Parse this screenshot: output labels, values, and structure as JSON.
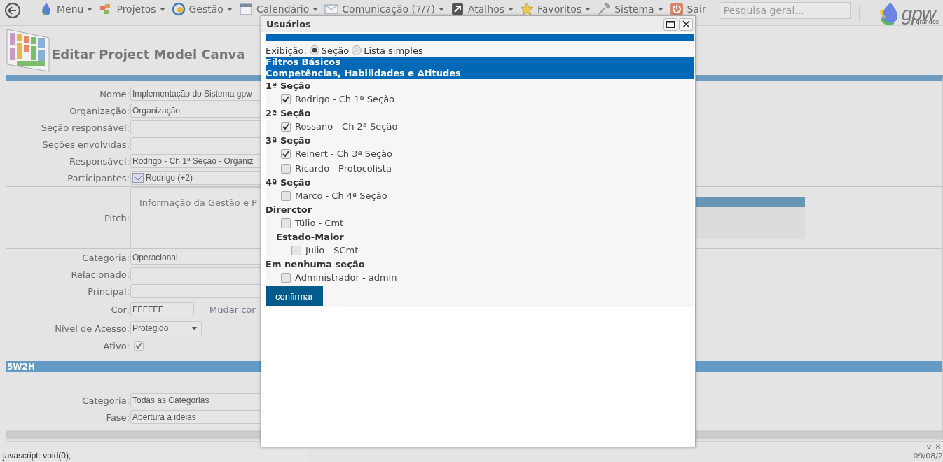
{
  "menu_bar": {
    "items": [
      {
        "kind": "menu",
        "label": "Menu",
        "dropdown": true
      },
      {
        "kind": "projects",
        "label": "Projetos",
        "dropdown": true
      },
      {
        "kind": "management",
        "label": "Gestão",
        "dropdown": true
      },
      {
        "kind": "calendar",
        "label": "Calendário",
        "dropdown": true
      },
      {
        "kind": "mail",
        "label": "Comunicação (7/7)",
        "dropdown": true
      },
      {
        "kind": "shortcut",
        "label": "Atalhos",
        "dropdown": true
      },
      {
        "kind": "star",
        "label": "Favoritos",
        "dropdown": true
      },
      {
        "kind": "wrench",
        "label": "Sistema",
        "dropdown": true
      },
      {
        "kind": "power",
        "label": "Sair",
        "dropdown": false
      }
    ],
    "search": {
      "placeholder": "Pesquisa geral..."
    },
    "logo": {
      "text": "gpw",
      "tagline": "grandes"
    }
  },
  "page": {
    "title": "Editar Project Model Canva"
  },
  "form": {
    "fields": [
      {
        "kind": "text",
        "label": "Nome:",
        "value": "Implementação do Sistema gpw"
      },
      {
        "kind": "text",
        "label": "Organização:",
        "value": "Organização"
      },
      {
        "kind": "text",
        "label": "Seção responsável:"
      },
      {
        "kind": "text",
        "label": "Seções envolvidas:"
      },
      {
        "kind": "text",
        "label": "Responsável:",
        "value": "Rodrigo - Ch 1ª Seção - Organiz"
      },
      {
        "kind": "participants",
        "label": "Participantes:",
        "value": "Rodrigo (+2)"
      },
      {
        "kind": "textarea",
        "label": "Pitch:",
        "value": "Informação da Gestão e P"
      },
      {
        "kind": "text",
        "label": "Categoria:",
        "value": "Operacional"
      },
      {
        "kind": "text",
        "label": "Relacionado:"
      },
      {
        "kind": "text",
        "label": "Principal:"
      },
      {
        "kind": "color",
        "label": "Cor:",
        "value": "FFFFFF",
        "link": "Mudar cor"
      },
      {
        "kind": "select",
        "label": "Nível de Acesso:",
        "value": "Protegido"
      },
      {
        "kind": "checkbox",
        "label": "Ativo:",
        "checked": true,
        "disabled": true
      }
    ]
  },
  "section": {
    "title": "5W2H",
    "fields": [
      {
        "kind": "text",
        "label": "Categoria:",
        "value": "Todas as Categorias"
      },
      {
        "kind": "text",
        "label": "Fase:",
        "value": "Abertura a ideias"
      }
    ]
  },
  "footer": {
    "version": "v. 8.",
    "date": "09/08/2"
  },
  "status_bar": "javascript: void(0);",
  "dialog": {
    "title": "Usuários",
    "display_label": "Exibição:",
    "display_options": [
      {
        "label": "Seção",
        "selected": true
      },
      {
        "label": "Lista simples",
        "selected": false
      }
    ],
    "filter_header": [
      "Filtros Básicos",
      "Competências, Habilidades e Atitudes"
    ],
    "groups": [
      {
        "title": "1ª Seção",
        "members": [
          {
            "label": "Rodrigo - Ch 1ª Seção",
            "checked": true
          }
        ]
      },
      {
        "title": "2ª Seção",
        "members": [
          {
            "label": "Rossano - Ch 2ª Seção",
            "checked": true
          }
        ]
      },
      {
        "title": "3ª Seção",
        "members": [
          {
            "label": "Reinert - Ch 3ª Seção",
            "checked": true
          },
          {
            "label": "Ricardo - Protocolista",
            "checked": false
          }
        ]
      },
      {
        "title": "4ª Seção",
        "members": [
          {
            "label": "Marco - Ch 4ª Seção",
            "checked": false
          }
        ]
      },
      {
        "title": "Direrctor",
        "members": [
          {
            "label": "Túlio - Cmt",
            "checked": false
          }
        ],
        "children": [
          {
            "title": "Estado-Maior",
            "members": [
              {
                "label": "Julio - SCmt",
                "checked": false
              }
            ]
          }
        ]
      },
      {
        "title": "Em nenhuma seção",
        "members": [
          {
            "label": "Administrador - admin",
            "checked": false
          }
        ]
      }
    ],
    "confirm_button": "confirmar"
  }
}
